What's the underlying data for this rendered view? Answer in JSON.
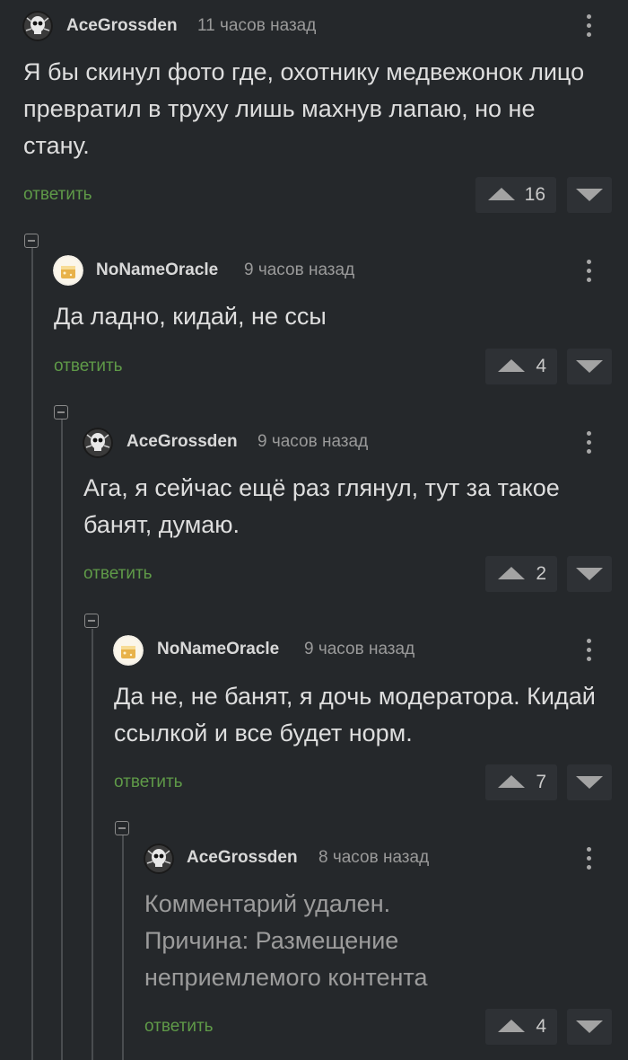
{
  "colors": {
    "background": "#25282b",
    "reply_link": "#5f9a48",
    "vote_bg": "#2e3135"
  },
  "comments": [
    {
      "author": "AceGrossden",
      "time": "11 часов назад",
      "text": "Я бы скинул фото где, охотнику медвежонок лицо превратил в труху лишь махнув лапаю, но не стану.",
      "reply_label": "ответить",
      "rating": "16",
      "avatar": "skull-avatar"
    },
    {
      "author": "NoNameOracle",
      "time": "9 часов назад",
      "text": "Да ладно, кидай, не ссы",
      "reply_label": "ответить",
      "rating": "4",
      "avatar": "oracle-avatar"
    },
    {
      "author": "AceGrossden",
      "time": "9 часов назад",
      "text": "Ага, я сейчас ещё раз глянул, тут за такое банят, думаю.",
      "reply_label": "ответить",
      "rating": "2",
      "avatar": "skull-avatar"
    },
    {
      "author": "NoNameOracle",
      "time": "9 часов назад",
      "text": "Да не, не банят, я дочь модератора. Кидай ссылкой и все будет норм.",
      "reply_label": "ответить",
      "rating": "7",
      "avatar": "oracle-avatar"
    },
    {
      "author": "AceGrossden",
      "time": "8 часов назад",
      "text": "Комментарий удален. Причина: Размещение неприемлемого контента",
      "reply_label": "ответить",
      "rating": "4",
      "avatar": "skull-avatar",
      "deleted": true
    }
  ]
}
